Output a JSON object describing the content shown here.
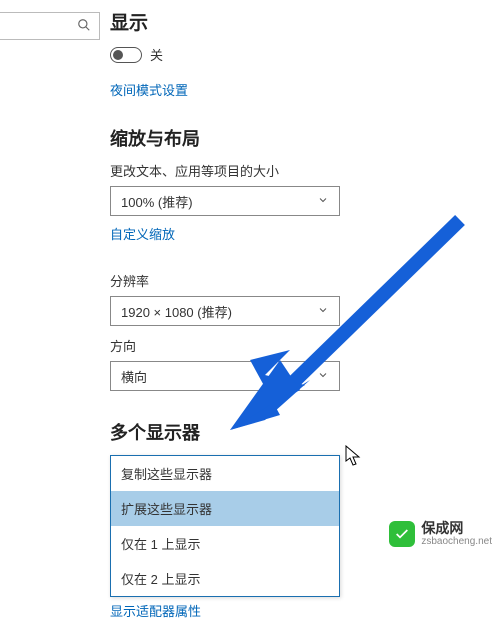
{
  "search": {
    "placeholder": ""
  },
  "display": {
    "heading": "显示",
    "toggle_state": "关",
    "night_link": "夜间模式设置"
  },
  "scale_section": {
    "heading": "缩放与布局",
    "scale_label": "更改文本、应用等项目的大小",
    "scale_value": "100% (推荐)",
    "custom_link": "自定义缩放",
    "resolution_label": "分辨率",
    "resolution_value": "1920 × 1080 (推荐)",
    "orientation_label": "方向",
    "orientation_value": "横向"
  },
  "multi": {
    "heading": "多个显示器",
    "options": {
      "0": "复制这些显示器",
      "1": "扩展这些显示器",
      "2": "仅在 1 上显示",
      "3": "仅在 2 上显示"
    },
    "adapter_link": "显示适配器属性"
  },
  "watermark": {
    "brand": "保成网",
    "url": "zsbaocheng.net"
  }
}
